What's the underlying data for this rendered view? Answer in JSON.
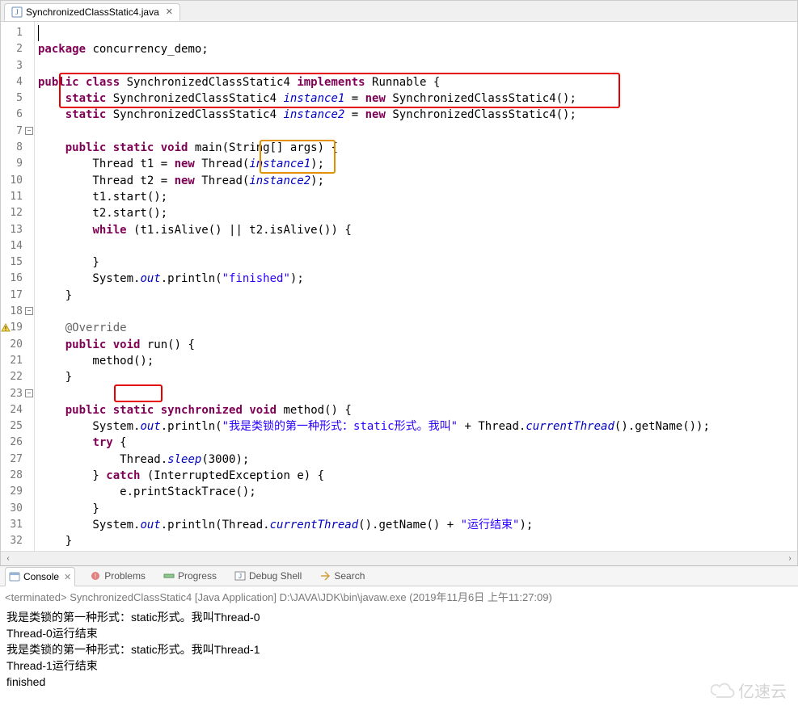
{
  "tab": {
    "filename": "SynchronizedClassStatic4.java"
  },
  "views": {
    "console": "Console",
    "problems": "Problems",
    "progress": "Progress",
    "debugshell": "Debug Shell",
    "search": "Search"
  },
  "code": {
    "lines": [
      {
        "n": "1"
      },
      {
        "n": "2"
      },
      {
        "n": "3"
      },
      {
        "n": "4"
      },
      {
        "n": "5"
      },
      {
        "n": "6"
      },
      {
        "n": "7",
        "fold": true
      },
      {
        "n": "8"
      },
      {
        "n": "9"
      },
      {
        "n": "10"
      },
      {
        "n": "11"
      },
      {
        "n": "12"
      },
      {
        "n": "13"
      },
      {
        "n": "14"
      },
      {
        "n": "15"
      },
      {
        "n": "16"
      },
      {
        "n": "17"
      },
      {
        "n": "18",
        "fold": true
      },
      {
        "n": "19",
        "warn": true
      },
      {
        "n": "20"
      },
      {
        "n": "21"
      },
      {
        "n": "22"
      },
      {
        "n": "23",
        "fold": true
      },
      {
        "n": "24"
      },
      {
        "n": "25"
      },
      {
        "n": "26"
      },
      {
        "n": "27"
      },
      {
        "n": "28"
      },
      {
        "n": "29"
      },
      {
        "n": "30"
      },
      {
        "n": "31"
      },
      {
        "n": "32"
      }
    ],
    "l1_kw_package": "package",
    "l1_pkg": " concurrency_demo;",
    "l3_kw_public": "public",
    "l3_kw_class": "class",
    "l3_name": " SynchronizedClassStatic4 ",
    "l3_kw_impl": "implements",
    "l3_iface": " Runnable {",
    "l4_kw_static": "static",
    "l4_type": " SynchronizedClassStatic4 ",
    "l4_var": "instance1",
    "l4_eq": " = ",
    "l4_kw_new": "new",
    "l4_rest": " SynchronizedClassStatic4();",
    "l5_kw_static": "static",
    "l5_type": " SynchronizedClassStatic4 ",
    "l5_var": "instance2",
    "l5_eq": " = ",
    "l5_kw_new": "new",
    "l5_rest": " SynchronizedClassStatic4();",
    "l7_kw_public": "public",
    "l7_kw_static": "static",
    "l7_kw_void": "void",
    "l7_sig": " main(String[] args) {",
    "l8_a": "        Thread t1 = ",
    "l8_kw_new": "new",
    "l8_b": " Thread(",
    "l8_var": "instance1",
    "l8_c": ");",
    "l9_a": "        Thread t2 = ",
    "l9_kw_new": "new",
    "l9_b": " Thread(",
    "l9_var": "instance2",
    "l9_c": ");",
    "l10": "        t1.start();",
    "l11": "        t2.start();",
    "l12_a": "        ",
    "l12_kw_while": "while",
    "l12_b": " (t1.isAlive() || t2.isAlive()) {",
    "l14": "        }",
    "l15_a": "        System.",
    "l15_out": "out",
    "l15_b": ".println(",
    "l15_str": "\"finished\"",
    "l15_c": ");",
    "l16": "    }",
    "l18": "    @Override",
    "l19_kw_public": "public",
    "l19_kw_void": "void",
    "l19_sig": " run() {",
    "l20": "        method();",
    "l21": "    }",
    "l23_kw_public": "public",
    "l23_kw_static": "static",
    "l23_kw_sync": "synchronized",
    "l23_kw_void": "void",
    "l23_sig": " method() {",
    "l24_a": "        System.",
    "l24_out": "out",
    "l24_b": ".println(",
    "l24_str": "\"我是类锁的第一种形式：static形式。我叫\"",
    "l24_c": " + Thread.",
    "l24_ct": "currentThread",
    "l24_d": "().getName());",
    "l25_a": "        ",
    "l25_kw_try": "try",
    "l25_b": " {",
    "l26_a": "            Thread.",
    "l26_sleep": "sleep",
    "l26_b": "(3000);",
    "l27_a": "        } ",
    "l27_kw_catch": "catch",
    "l27_b": " (InterruptedException e) {",
    "l28": "            e.printStackTrace();",
    "l29": "        }",
    "l30_a": "        System.",
    "l30_out": "out",
    "l30_b": ".println(Thread.",
    "l30_ct": "currentThread",
    "l30_c": "().getName() + ",
    "l30_str": "\"运行结束\"",
    "l30_d": ");",
    "l31": "    }",
    "l32": "}"
  },
  "console_header": "<terminated> SynchronizedClassStatic4 [Java Application] D:\\JAVA\\JDK\\bin\\javaw.exe (2019年11月6日 上午11:27:09)",
  "console": {
    "r1": "我是类锁的第一种形式：static形式。我叫Thread-0",
    "r2": "Thread-0运行结束",
    "r3": "我是类锁的第一种形式：static形式。我叫Thread-1",
    "r4": "Thread-1运行结束",
    "r5": "finished"
  },
  "watermark": "亿速云"
}
